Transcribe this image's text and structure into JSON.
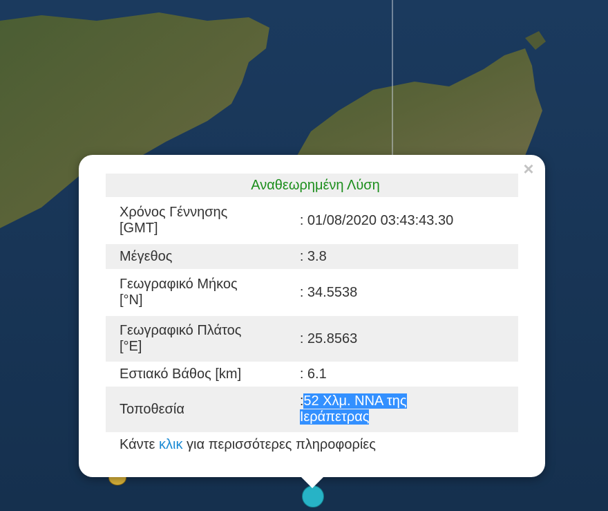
{
  "popup": {
    "close_symbol": "×",
    "header": "Αναθεωρημένη Λύση",
    "rows": [
      {
        "label_line1": "Χρόνος Γέννησης",
        "label_line2": "[GMT]",
        "value": ": 01/08/2020 03:43:43.30"
      },
      {
        "label_line1": "Μέγεθος",
        "value": ": 3.8"
      },
      {
        "label_line1": "Γεωγραφικό Μήκος",
        "label_line2": "[°N]",
        "value": ": 34.5538"
      },
      {
        "label_line1": "Γεωγραφικό Πλάτος",
        "label_line2": "[°E]",
        "value": ": 25.8563"
      },
      {
        "label_line1": "Εστιακό Βάθος [km]",
        "value": ": 6.1"
      },
      {
        "label_line1": "Τοποθεσία",
        "value_prefix": ":",
        "value_line1": "52 Χλμ. ΝΝΑ της",
        "value_line2": "Ιεράπετρας"
      }
    ],
    "footer_before": "Κάντε ",
    "footer_link": "κλικ",
    "footer_after": " για περισσότερες πληροφορίες"
  },
  "colors": {
    "header_text": "#1c8e1c",
    "link": "#1a8ad4",
    "selection": "#3390ff",
    "marker_main": "#27b3c6",
    "marker_other": "#d8b23a"
  }
}
